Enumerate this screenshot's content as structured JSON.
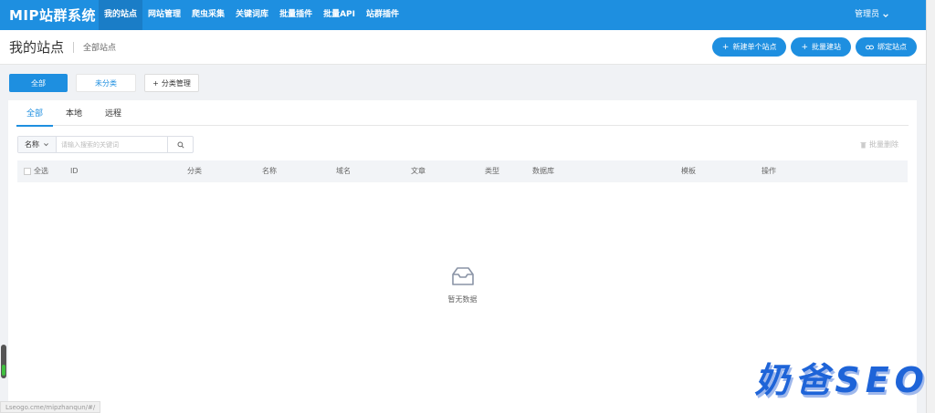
{
  "app": {
    "title": "MIP站群系统"
  },
  "topnav": {
    "items": [
      {
        "label": "我的站点",
        "active": true
      },
      {
        "label": "网站管理"
      },
      {
        "label": "爬虫采集"
      },
      {
        "label": "关键词库"
      },
      {
        "label": "批量插件"
      },
      {
        "label": "批量API"
      },
      {
        "label": "站群插件"
      }
    ],
    "user": "管理员"
  },
  "header": {
    "title": "我的站点",
    "breadcrumb": "全部站点",
    "actions": [
      {
        "label": "新建单个站点",
        "icon": "plus-icon"
      },
      {
        "label": "批量建站",
        "icon": "plus-icon"
      },
      {
        "label": "绑定站点",
        "icon": "link-icon"
      }
    ]
  },
  "categories": {
    "all": "全部",
    "uncategorized": "未分类",
    "manage": "分类管理"
  },
  "tabs": [
    "全部",
    "本地",
    "远程"
  ],
  "search": {
    "select_value": "名称",
    "placeholder": "请输入搜索的关键词"
  },
  "batch_delete": "批量删除",
  "table": {
    "select_all": "全选",
    "columns": [
      "ID",
      "分类",
      "名称",
      "域名",
      "文章",
      "类型",
      "数据库",
      "模板",
      "操作"
    ]
  },
  "empty_text": "暂无数据",
  "status_url": "Lseogo.cme/mipzhanqun/#/",
  "watermark": "奶爸SEO",
  "colors": {
    "primary": "#1e8fe0",
    "nav_active": "#1a7dc7",
    "background": "#f0f2f5"
  }
}
